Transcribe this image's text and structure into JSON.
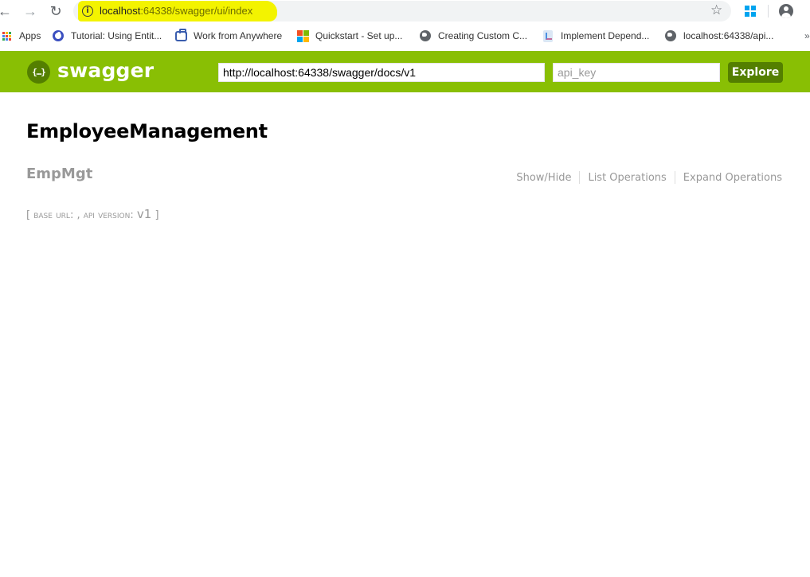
{
  "browser": {
    "url_host": "localhost",
    "url_rest": ":64338/swagger/ui/index",
    "bookmarks": [
      {
        "label": "Apps"
      },
      {
        "label": "Tutorial: Using Entit..."
      },
      {
        "label": "Work from Anywhere"
      },
      {
        "label": "Quickstart - Set up..."
      },
      {
        "label": "Creating Custom C..."
      },
      {
        "label": "Implement Depend..."
      },
      {
        "label": "localhost:64338/api..."
      }
    ],
    "more_label": "»"
  },
  "swagger_header": {
    "logo_glyph": "{…}",
    "logo_text": "swagger",
    "url_value": "http://localhost:64338/swagger/docs/v1",
    "api_key_placeholder": "api_key",
    "explore_label": "Explore",
    "bar_color": "#89bf04",
    "accent_color": "#547f00"
  },
  "main": {
    "title": "EmployeeManagement",
    "resource": {
      "name": "EmpMgt",
      "operations": [
        "Show/Hide",
        "List Operations",
        "Expand Operations"
      ]
    },
    "info": {
      "open": "[ ",
      "base_url_label": "base url",
      "base_url_value": ": , ",
      "api_version_label": "api version",
      "api_version_sep": ": ",
      "api_version_value": "v1",
      "close": " ]"
    }
  }
}
